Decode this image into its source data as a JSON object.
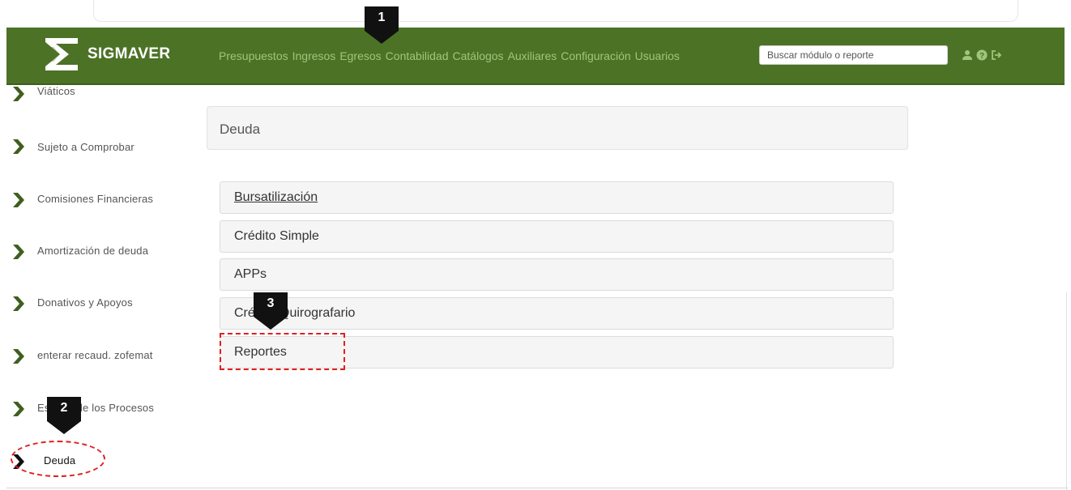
{
  "app": {
    "name": "SIGMAVER"
  },
  "nav": {
    "menu": [
      "Presupuestos",
      "Ingresos",
      "Egresos",
      "Contabilidad",
      "Catálogos",
      "Auxiliares",
      "Configuración",
      "Usuarios"
    ],
    "search_placeholder": "Buscar módulo o reporte",
    "icons": [
      "user-icon",
      "help-icon",
      "logout-icon"
    ]
  },
  "sidebar": {
    "items": [
      "Viáticos",
      "Sujeto a Comprobar",
      "Comisiones Financieras",
      "Amortización de deuda",
      "Donativos y Apoyos",
      "enterar recaud. zofemat",
      "Estatus de los Procesos",
      "Deuda"
    ]
  },
  "panel": {
    "title": "Deuda"
  },
  "list": [
    "Bursatilización",
    "Crédito Simple",
    "APPs",
    "Crédito Quirografario",
    "Reportes"
  ],
  "callouts": [
    "1",
    "2",
    "3"
  ],
  "colors": {
    "navbar": "#4c7226",
    "menu_text": "#9fc67a",
    "chevron": "#3f5f1f",
    "highlight": "#e02020"
  }
}
